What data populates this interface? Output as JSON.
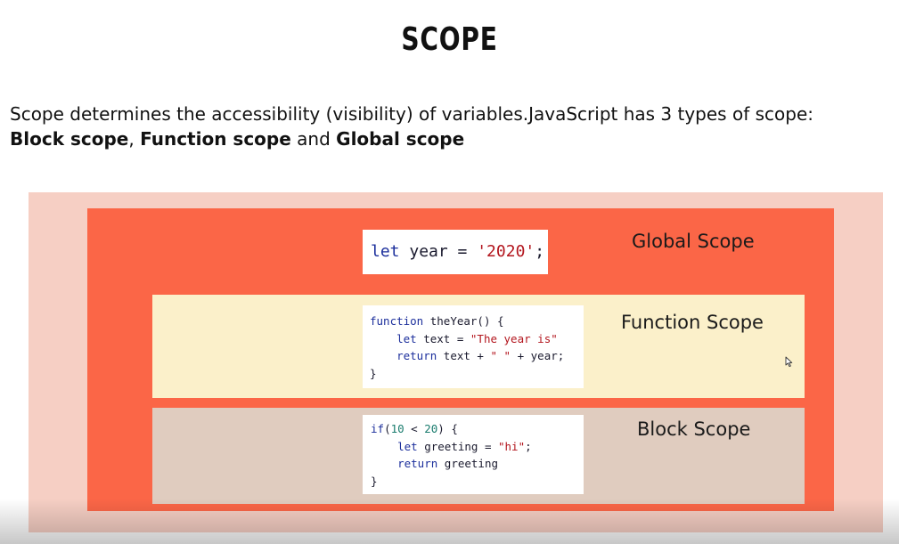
{
  "title": "SCOPE",
  "intro": {
    "line1": "Scope determines the accessibility (visibility) of variables.JavaScript has 3 types of scope:",
    "block_scope": "Block scope",
    "comma": ", ",
    "function_scope": "Function scope",
    "and": " and ",
    "global_scope": "Global scope"
  },
  "diagram": {
    "global": {
      "label": "Global Scope",
      "code": {
        "kw": "let",
        "mid": " year = ",
        "str": "'2020'",
        "end": ";"
      }
    },
    "function": {
      "label": "Function Scope",
      "code": {
        "l1_kw": "function",
        "l1_rest": " theYear() {",
        "l2_indent": "    ",
        "l2_kw": "let",
        "l2_mid": " text = ",
        "l2_str": "\"The year is\"",
        "l3_indent": "    ",
        "l3_kw": "return",
        "l3_mid": " text + ",
        "l3_str": "\" \"",
        "l3_end": " + year;",
        "l4": "}"
      }
    },
    "block": {
      "label": "Block Scope",
      "code": {
        "l1_kw": "if",
        "l1_p1": "(",
        "l1_n1": "10",
        "l1_op": " < ",
        "l1_n2": "20",
        "l1_end": ") {",
        "l2_indent": "    ",
        "l2_kw": "let",
        "l2_mid": " greeting = ",
        "l2_str": "\"hi\"",
        "l2_end": ";",
        "l3_indent": "    ",
        "l3_kw": "return",
        "l3_end": " greeting",
        "l4": "}"
      }
    }
  },
  "colors": {
    "outer": "#f6cfc4",
    "global": "#fb6647",
    "function": "#fbf0ca",
    "block": "#e0ccbf"
  },
  "icons": [
    "mouse-cursor-icon"
  ]
}
